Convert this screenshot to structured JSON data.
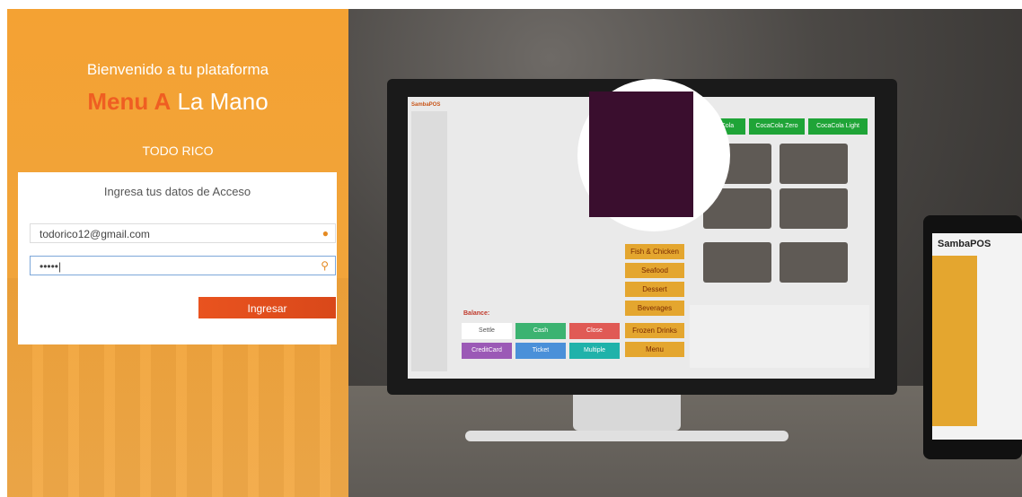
{
  "hero": {
    "welcome": "Bienvenido a tu plataforma",
    "brand_accent": "Menu A",
    "brand_rest": " La Mano",
    "tagline": "TODO RICO"
  },
  "login": {
    "title": "Ingresa tus datos de Acceso",
    "email_value": "todorico12@gmail.com",
    "password_value": "•••••|",
    "submit_label": "Ingresar"
  },
  "background": {
    "pos_logo": "SambaPOS",
    "drinks": [
      "aCola",
      "CocaCola Zero",
      "CocaCola Light"
    ],
    "categories": [
      "Fish & Chicken",
      "Seafood",
      "Dessert",
      "Beverages",
      "Frozen Drinks",
      "Menu"
    ],
    "buttons": [
      "Settle",
      "Cash",
      "Close",
      "CreditCard",
      "Ticket",
      "Multiple"
    ],
    "balance_label": "Balance:",
    "tablet_logo": "SambaPOS"
  },
  "colors": {
    "accent": "#ef5e22",
    "panel": "#f4a233",
    "button": "#e9531f"
  }
}
